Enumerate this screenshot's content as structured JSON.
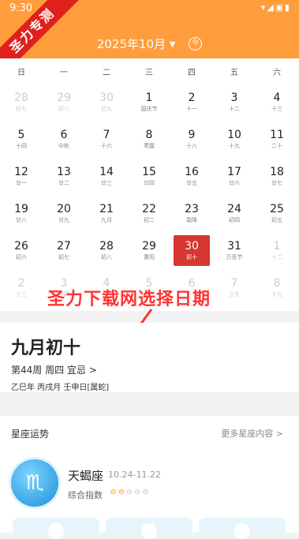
{
  "status": {
    "time": "9:30",
    "icons": "▾◢▣▮"
  },
  "watermark": "圣力专测",
  "calendar": {
    "month_label": "2025年10月",
    "dropdown_icon": "▾",
    "jin_icon": "今",
    "weekdays": [
      "日",
      "一",
      "二",
      "三",
      "四",
      "五",
      "六"
    ],
    "weeks": [
      [
        {
          "n": "28",
          "l": "初七",
          "dim": true
        },
        {
          "n": "29",
          "l": "初八",
          "dim": true
        },
        {
          "n": "30",
          "l": "初九",
          "dim": true
        },
        {
          "n": "1",
          "l": "国庆节"
        },
        {
          "n": "2",
          "l": "十一"
        },
        {
          "n": "3",
          "l": "十二"
        },
        {
          "n": "4",
          "l": "十三"
        }
      ],
      [
        {
          "n": "5",
          "l": "十四"
        },
        {
          "n": "6",
          "l": "中秋"
        },
        {
          "n": "7",
          "l": "十六"
        },
        {
          "n": "8",
          "l": "寒露"
        },
        {
          "n": "9",
          "l": "十八"
        },
        {
          "n": "10",
          "l": "十九"
        },
        {
          "n": "11",
          "l": "二十"
        }
      ],
      [
        {
          "n": "12",
          "l": "廿一"
        },
        {
          "n": "13",
          "l": "廿二"
        },
        {
          "n": "14",
          "l": "廿三"
        },
        {
          "n": "15",
          "l": "廿四"
        },
        {
          "n": "16",
          "l": "廿五"
        },
        {
          "n": "17",
          "l": "廿六"
        },
        {
          "n": "18",
          "l": "廿七"
        }
      ],
      [
        {
          "n": "19",
          "l": "廿八"
        },
        {
          "n": "20",
          "l": "廿九"
        },
        {
          "n": "21",
          "l": "九月"
        },
        {
          "n": "22",
          "l": "初二"
        },
        {
          "n": "23",
          "l": "霜降"
        },
        {
          "n": "24",
          "l": "初四"
        },
        {
          "n": "25",
          "l": "初五"
        }
      ],
      [
        {
          "n": "26",
          "l": "初六"
        },
        {
          "n": "27",
          "l": "初七"
        },
        {
          "n": "28",
          "l": "初八"
        },
        {
          "n": "29",
          "l": "重阳"
        },
        {
          "n": "30",
          "l": "初十",
          "sel": true
        },
        {
          "n": "31",
          "l": "万圣节"
        },
        {
          "n": "1",
          "l": "十二",
          "dim": true
        }
      ],
      [
        {
          "n": "2",
          "l": "十三",
          "dim": true
        },
        {
          "n": "3",
          "l": "十四",
          "dim": true
        },
        {
          "n": "4",
          "l": "十五",
          "dim": true
        },
        {
          "n": "5",
          "l": "十六",
          "dim": true
        },
        {
          "n": "6",
          "l": "十七",
          "dim": true
        },
        {
          "n": "7",
          "l": "立冬",
          "dim": true
        },
        {
          "n": "8",
          "l": "十九",
          "dim": true
        }
      ]
    ]
  },
  "overlay_text": "圣力下载网选择日期",
  "info": {
    "lunar_date": "九月初十",
    "week_line": "第44周  周四  宜忌  >",
    "ganzhi": "乙巳年 丙戌月 壬申日[属蛇]"
  },
  "horoscope": {
    "title": "星座运势",
    "more": "更多星座内容  >",
    "symbol": "♏",
    "name": "天蝎座",
    "dates": "10.24-11.22",
    "index_label": "综合指数",
    "rating": 2,
    "rating_max": 5
  }
}
